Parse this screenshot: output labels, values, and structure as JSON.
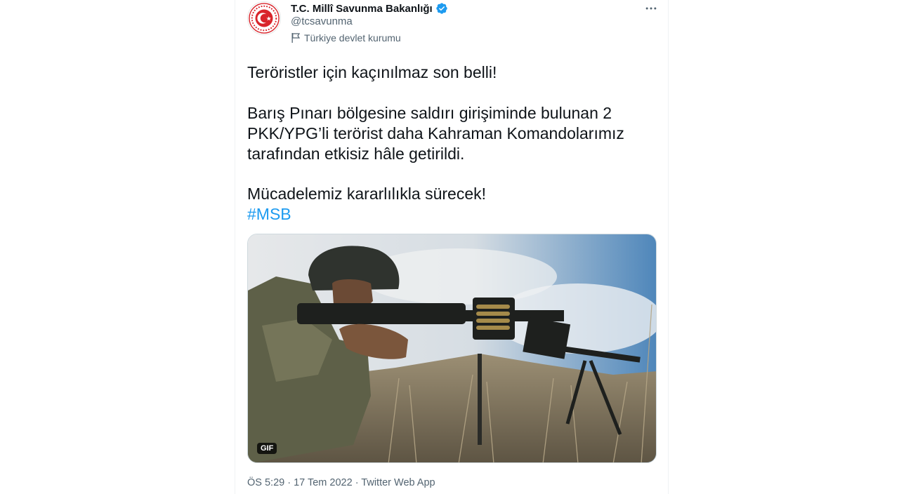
{
  "account": {
    "display_name": "T.C. Millî Savunma Bakanlığı",
    "handle": "@tcsavunma",
    "label": "Türkiye devlet kurumu",
    "avatar_icon": "ministry-seal-icon",
    "verified_icon": "verified-badge-icon",
    "verified_color": "#1d9bf0"
  },
  "tweet": {
    "line1": "Teröristler için kaçınılmaz son belli!",
    "para2_line1": "Barış Pınarı bölgesine saldırı girişiminde bulunan 2",
    "para2_line2": "PKK/YPG’li terörist daha Kahraman Komandolarımız",
    "para2_line3": "tarafından etkisiz hâle getirildi.",
    "line3": "Mücadelemiz kararlılıkla sürecek!",
    "hashtag": "#MSB"
  },
  "media": {
    "badge": "GIF",
    "alt": ""
  },
  "meta": {
    "time": "ÖS 5:29",
    "sep1": " · ",
    "date": "17 Tem 2022",
    "sep2": " · ",
    "source": "Twitter Web App"
  },
  "icons": {
    "more": "more-options-icon",
    "label": "flag-icon"
  }
}
